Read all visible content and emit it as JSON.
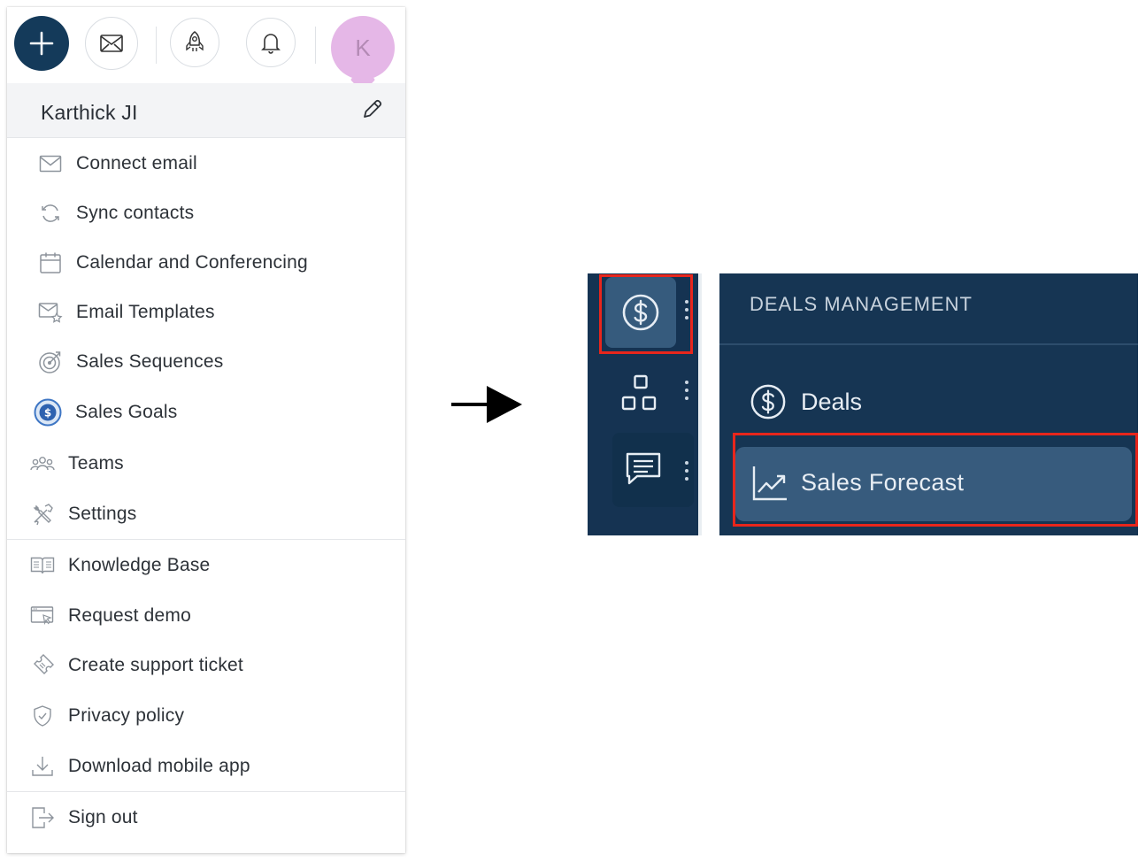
{
  "topbar": {
    "add_icon": "plus-icon",
    "mail_icon": "envelope-icon",
    "rocket_icon": "rocket-icon",
    "bell_icon": "bell-icon",
    "avatar_initial": "K"
  },
  "user": {
    "name": "Karthick JI",
    "edit_icon": "pencil-icon"
  },
  "menu_group_1": [
    {
      "label": "Connect email",
      "icon": "envelope-icon"
    },
    {
      "label": "Sync contacts",
      "icon": "sync-icon"
    },
    {
      "label": "Calendar and Conferencing",
      "icon": "calendar-icon"
    },
    {
      "label": "Email Templates",
      "icon": "email-template-icon"
    },
    {
      "label": "Sales Sequences",
      "icon": "target-icon"
    },
    {
      "label": "Sales Goals",
      "icon": "goal-coin-icon"
    },
    {
      "label": "Teams",
      "icon": "teams-icon"
    },
    {
      "label": "Settings",
      "icon": "tools-icon"
    }
  ],
  "menu_group_2": [
    {
      "label": "Knowledge Base",
      "icon": "book-icon"
    },
    {
      "label": "Request demo",
      "icon": "demo-screen-icon"
    },
    {
      "label": "Create support ticket",
      "icon": "ticket-icon"
    },
    {
      "label": "Privacy policy",
      "icon": "shield-icon"
    },
    {
      "label": "Download mobile app",
      "icon": "download-icon"
    }
  ],
  "menu_group_3": [
    {
      "label": "Sign out",
      "icon": "sign-out-icon"
    }
  ],
  "flow_arrow": "right-arrow-icon",
  "deals_panel": {
    "header": "DEALS MANAGEMENT",
    "items": [
      {
        "label": "Deals",
        "icon": "dollar-circle-icon"
      },
      {
        "label": "Sales Forecast",
        "icon": "trend-chart-icon"
      }
    ],
    "rail": [
      "dollar-circle-icon",
      "apps-grid-icon",
      "chat-icon"
    ]
  },
  "colors": {
    "brand_navy": "#143a5a",
    "avatar_pink": "#e5b7e7",
    "sidebar_bg": "#163553",
    "active_item_bg": "#375b7d",
    "highlight_red": "#e8261c"
  }
}
